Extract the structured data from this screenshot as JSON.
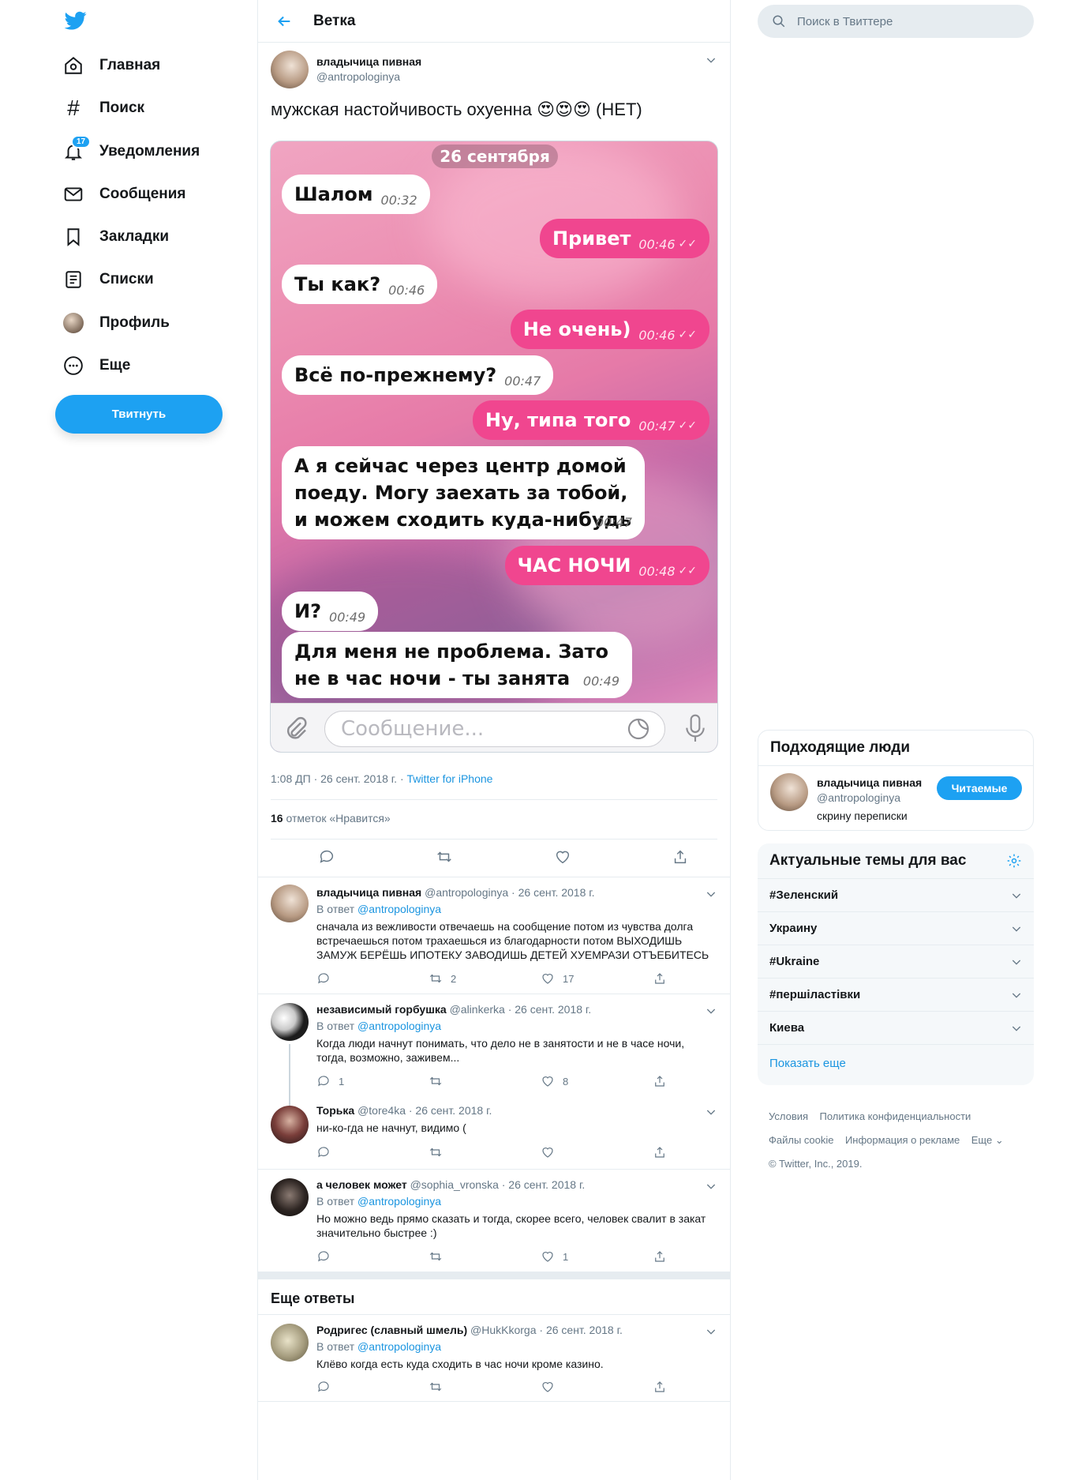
{
  "colors": {
    "accent": "#1da1f2",
    "bubble_out": "#f0468f",
    "link": "#1b95e0"
  },
  "nav": {
    "items": [
      {
        "label": "Главная",
        "icon": "home-icon"
      },
      {
        "label": "Поиск",
        "icon": "hashtag-icon"
      },
      {
        "label": "Уведомления",
        "icon": "bell-icon",
        "badge": "17"
      },
      {
        "label": "Сообщения",
        "icon": "mail-icon"
      },
      {
        "label": "Закладки",
        "icon": "bookmark-icon"
      },
      {
        "label": "Списки",
        "icon": "list-icon"
      },
      {
        "label": "Профиль",
        "icon": "avatar"
      },
      {
        "label": "Еще",
        "icon": "more-icon"
      }
    ],
    "tweet_button": "Твитнуть"
  },
  "header": {
    "title": "Ветка"
  },
  "tweet": {
    "name": "владычица пивная",
    "handle": "@antropologinya",
    "text": "мужская настойчивость охуенна 😍😍😍 (НЕТ)",
    "time": "1:08 ДП · 26 сент. 2018 г. · ",
    "source": "Twitter for iPhone",
    "likes_count": "16",
    "likes_label": " отметок «Нравится»"
  },
  "chat": {
    "date": "26 сентября",
    "messages": [
      {
        "dir": "in",
        "text": "Шалом",
        "time": "00:32"
      },
      {
        "dir": "out",
        "text": "Привет",
        "time": "00:46"
      },
      {
        "dir": "in",
        "text": "Ты как?",
        "time": "00:46"
      },
      {
        "dir": "out",
        "text": "Не очень)",
        "time": "00:46"
      },
      {
        "dir": "in",
        "text": "Всё по-прежнему?",
        "time": "00:47"
      },
      {
        "dir": "out",
        "text": "Ну, типа того",
        "time": "00:47"
      },
      {
        "dir": "in",
        "text": "А я сейчас через центр домой поеду. Могу заехать за тобой, и можем сходить куда-нибудь",
        "time": "00:47"
      },
      {
        "dir": "out",
        "text": "ЧАС НОЧИ",
        "time": "00:48"
      },
      {
        "dir": "in",
        "text": "И?",
        "time": "00:49"
      },
      {
        "dir": "in",
        "text": "Для меня не проблема. Зато не в час ночи - ты занята",
        "time": "00:49"
      }
    ],
    "input_placeholder": "Сообщение..."
  },
  "replies": [
    {
      "name": "владычица пивная",
      "meta": "@antropologinya · 26 сент. 2018 г.",
      "reply_to_prefix": "В ответ ",
      "reply_to": "@antropologinya",
      "text": "сначала из вежливости отвечаешь на сообщение потом из чувства долга встречаешься потом трахаешься из благодарности потом ВЫХОДИШЬ ЗАМУЖ БЕРЁШЬ ИПОТЕКУ ЗАВОДИШЬ ДЕТЕЙ ХУЕМРАЗИ ОТЪЕБИТЕСЬ",
      "replies": "",
      "retweets": "2",
      "likes": "17"
    },
    {
      "name": "независимый горбушка",
      "meta": "@alinkerka · 26 сент. 2018 г.",
      "reply_to_prefix": "В ответ ",
      "reply_to": "@antropologinya",
      "text": "Когда люди начнут понимать, что дело не в занятости и не в часе ночи, тогда, возможно, заживем...",
      "replies": "1",
      "retweets": "",
      "likes": "8"
    },
    {
      "name": "Торька",
      "meta": "@tore4ka · 26 сент. 2018 г.",
      "reply_to_prefix": "",
      "reply_to": "",
      "text": "ни-ко-гда не начнут, видимо (",
      "replies": "",
      "retweets": "",
      "likes": ""
    },
    {
      "name": "а человек может",
      "meta": "@sophia_vronska · 26 сент. 2018 г.",
      "reply_to_prefix": "В ответ ",
      "reply_to": "@antropologinya",
      "text": "Но можно ведь прямо сказать и тогда, скорее всего, человек свалит в закат значительно быстрее :)",
      "replies": "",
      "retweets": "",
      "likes": "1"
    }
  ],
  "more_replies": {
    "title": "Еще ответы",
    "items": [
      {
        "name": "Родригес (славный шмель)",
        "meta": "@HukKkorga · 26 сент. 2018 г.",
        "reply_to_prefix": "В ответ ",
        "reply_to": "@antropologinya",
        "text": "Клёво когда есть куда сходить в час ночи кроме казино.",
        "replies": "",
        "retweets": "",
        "likes": ""
      }
    ]
  },
  "search": {
    "placeholder": "Поиск в Твиттере"
  },
  "who_to_follow": {
    "title": "Подходящие люди",
    "name": "владычица пивная",
    "handle": "@antropologinya",
    "bio": "скрину переписки",
    "button": "Читаемые"
  },
  "trends": {
    "title": "Актуальные темы для вас",
    "items": [
      "#Зеленский",
      "Украину",
      "#Ukraine",
      "#першіластівки",
      "Киева"
    ],
    "show_more": "Показать еще"
  },
  "footer": {
    "links_row1": [
      "Условия",
      "Политика конфиденциальности"
    ],
    "links_row2": [
      "Файлы cookie",
      "Информация о рекламе",
      "Еще"
    ],
    "copyright": "© Twitter, Inc., 2019."
  }
}
